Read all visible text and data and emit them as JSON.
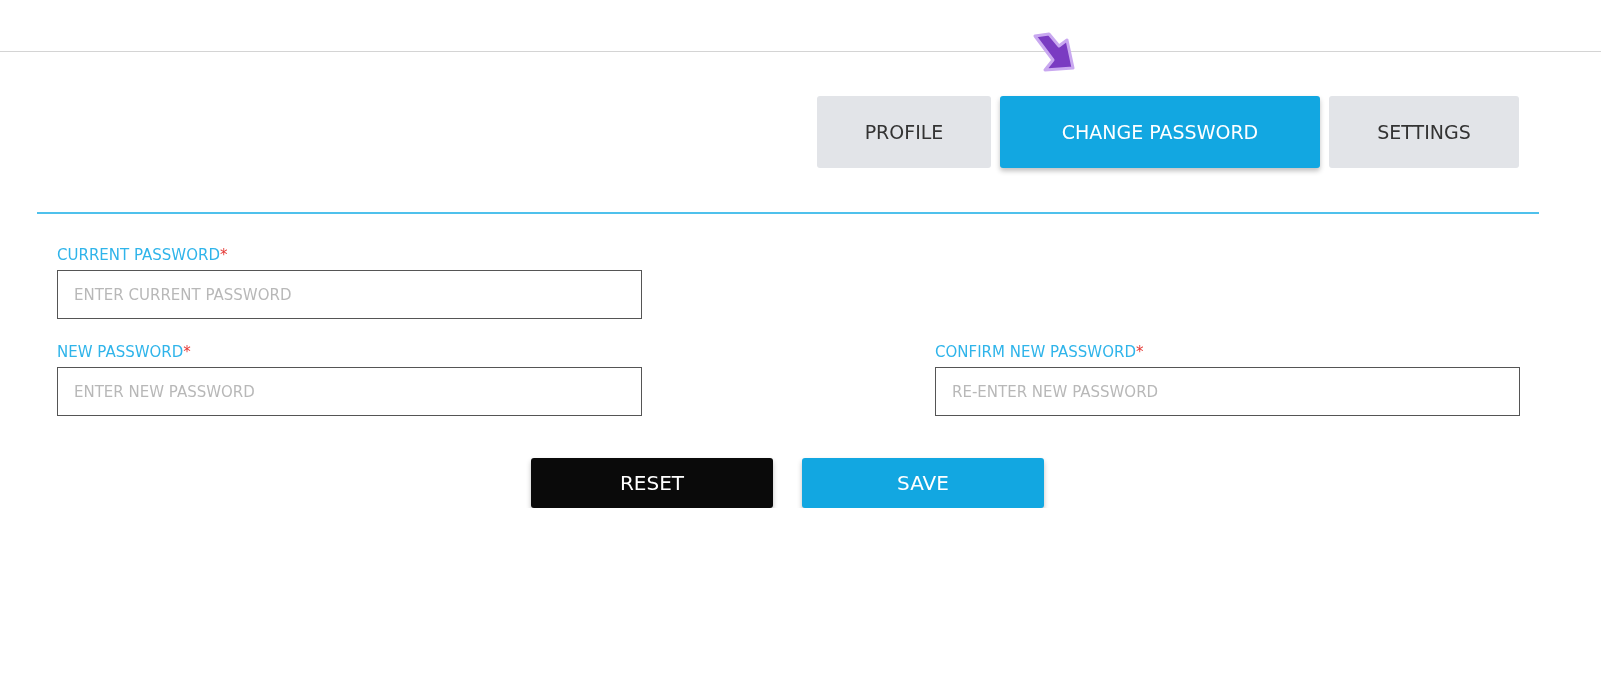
{
  "tabs": [
    {
      "label": "PROFILE",
      "selected": false
    },
    {
      "label": "CHANGE PASSWORD",
      "selected": true
    },
    {
      "label": "SETTINGS",
      "selected": false
    }
  ],
  "fields": [
    {
      "label": "CURRENT PASSWORD",
      "required_mark": "*",
      "placeholder": "ENTER CURRENT PASSWORD"
    },
    {
      "label": "NEW PASSWORD",
      "required_mark": "*",
      "placeholder": "ENTER NEW PASSWORD"
    },
    {
      "label": "CONFIRM NEW PASSWORD",
      "required_mark": "*",
      "placeholder": "RE-ENTER NEW PASSWORD"
    }
  ],
  "buttons": [
    {
      "label": "RESET",
      "kind": "secondary"
    },
    {
      "label": "SAVE",
      "kind": "primary"
    }
  ]
}
